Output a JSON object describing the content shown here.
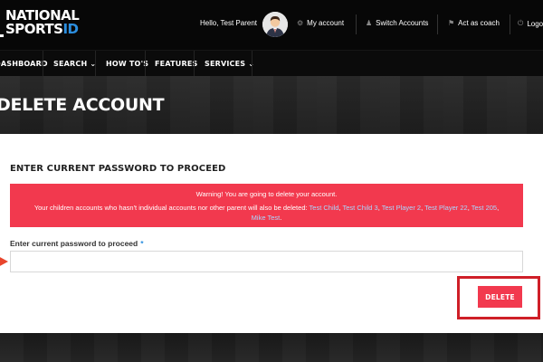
{
  "brand": {
    "line1": "NATIONAL",
    "line2_main": "SPORTS",
    "line2_accent": "ID"
  },
  "header": {
    "greeting": "Hello, Test Parent",
    "links": [
      {
        "label": "My account",
        "icon": "gear-icon"
      },
      {
        "label": "Switch Accounts",
        "icon": "users-icon"
      },
      {
        "label": "Act as coach",
        "icon": "coach-icon"
      },
      {
        "label": "Logout",
        "icon": "logout-icon"
      }
    ]
  },
  "nav": {
    "items": [
      {
        "label": "DASHBOARD",
        "has_dropdown": false
      },
      {
        "label": "SEARCH",
        "has_dropdown": true
      },
      {
        "label": "HOW TO'S",
        "has_dropdown": false
      },
      {
        "label": "FEATURES",
        "has_dropdown": false
      },
      {
        "label": "SERVICES",
        "has_dropdown": true
      }
    ]
  },
  "page": {
    "title": "DELETE ACCOUNT"
  },
  "form": {
    "heading": "ENTER CURRENT PASSWORD TO PROCEED",
    "alert": {
      "line1": "Warning! You are going to delete your account.",
      "line2_prefix": "Your children accounts who hasn't individual accounts nor other parent will also be deleted:",
      "children": [
        "Test Child",
        "Test Child 3",
        "Test Player 2",
        "Test Player 22",
        "Test 205",
        "Mike Test"
      ]
    },
    "password_label": "Enter current password to proceed",
    "required_mark": "*",
    "password_value": "",
    "submit_label": "DELETE"
  },
  "colors": {
    "accent_red": "#f2394e",
    "highlight_red": "#cf1f28",
    "link_blue": "#a9d7ff",
    "brand_blue": "#2c8fe0",
    "bar_dark": "#070707"
  }
}
